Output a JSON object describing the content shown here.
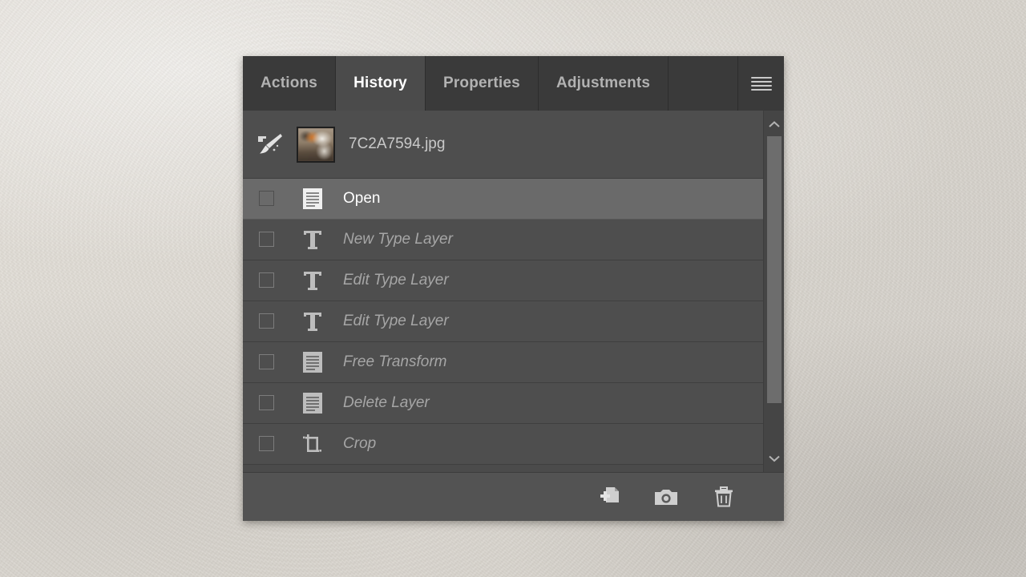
{
  "panel": {
    "tabs": [
      {
        "label": "Actions",
        "active": false,
        "name": "tab-actions"
      },
      {
        "label": "History",
        "active": true,
        "name": "tab-history"
      },
      {
        "label": "Properties",
        "active": false,
        "name": "tab-properties"
      },
      {
        "label": "Adjustments",
        "active": false,
        "name": "tab-adjustments"
      }
    ],
    "menu_icon": "hamburger-menu-icon",
    "document": {
      "source_icon": "history-brush-source-icon",
      "thumbnail": "document-thumbnail",
      "filename": "7C2A7594.jpg"
    },
    "states": [
      {
        "label": "Open",
        "icon": "document-icon",
        "selected": true
      },
      {
        "label": "New Type Layer",
        "icon": "type-icon",
        "selected": false
      },
      {
        "label": "Edit Type Layer",
        "icon": "type-icon",
        "selected": false
      },
      {
        "label": "Edit Type Layer",
        "icon": "type-icon",
        "selected": false
      },
      {
        "label": "Free Transform",
        "icon": "document-icon",
        "selected": false
      },
      {
        "label": "Delete Layer",
        "icon": "document-icon",
        "selected": false
      },
      {
        "label": "Crop",
        "icon": "crop-icon",
        "selected": false
      }
    ],
    "scrollbar": {
      "up_icon": "chevron-up-icon",
      "down_icon": "chevron-down-icon",
      "thumb": "scrollbar-thumb"
    },
    "toolbar": [
      {
        "name": "new-document-from-state-button",
        "icon": "document-plus-icon"
      },
      {
        "name": "new-snapshot-button",
        "icon": "camera-icon"
      },
      {
        "name": "delete-state-button",
        "icon": "trash-icon"
      }
    ],
    "colors": {
      "panel_bg": "#535353",
      "tabbar_bg": "#333333",
      "tab_inactive_bg": "#3a3a3a",
      "tab_active_bg": "#4b4b4b",
      "row_bg": "#4e4e4e",
      "row_selected_bg": "#6a6a6a",
      "text_muted": "#a6a6a6",
      "text_active": "#ffffff",
      "backdrop": "#ddd9d2"
    }
  }
}
